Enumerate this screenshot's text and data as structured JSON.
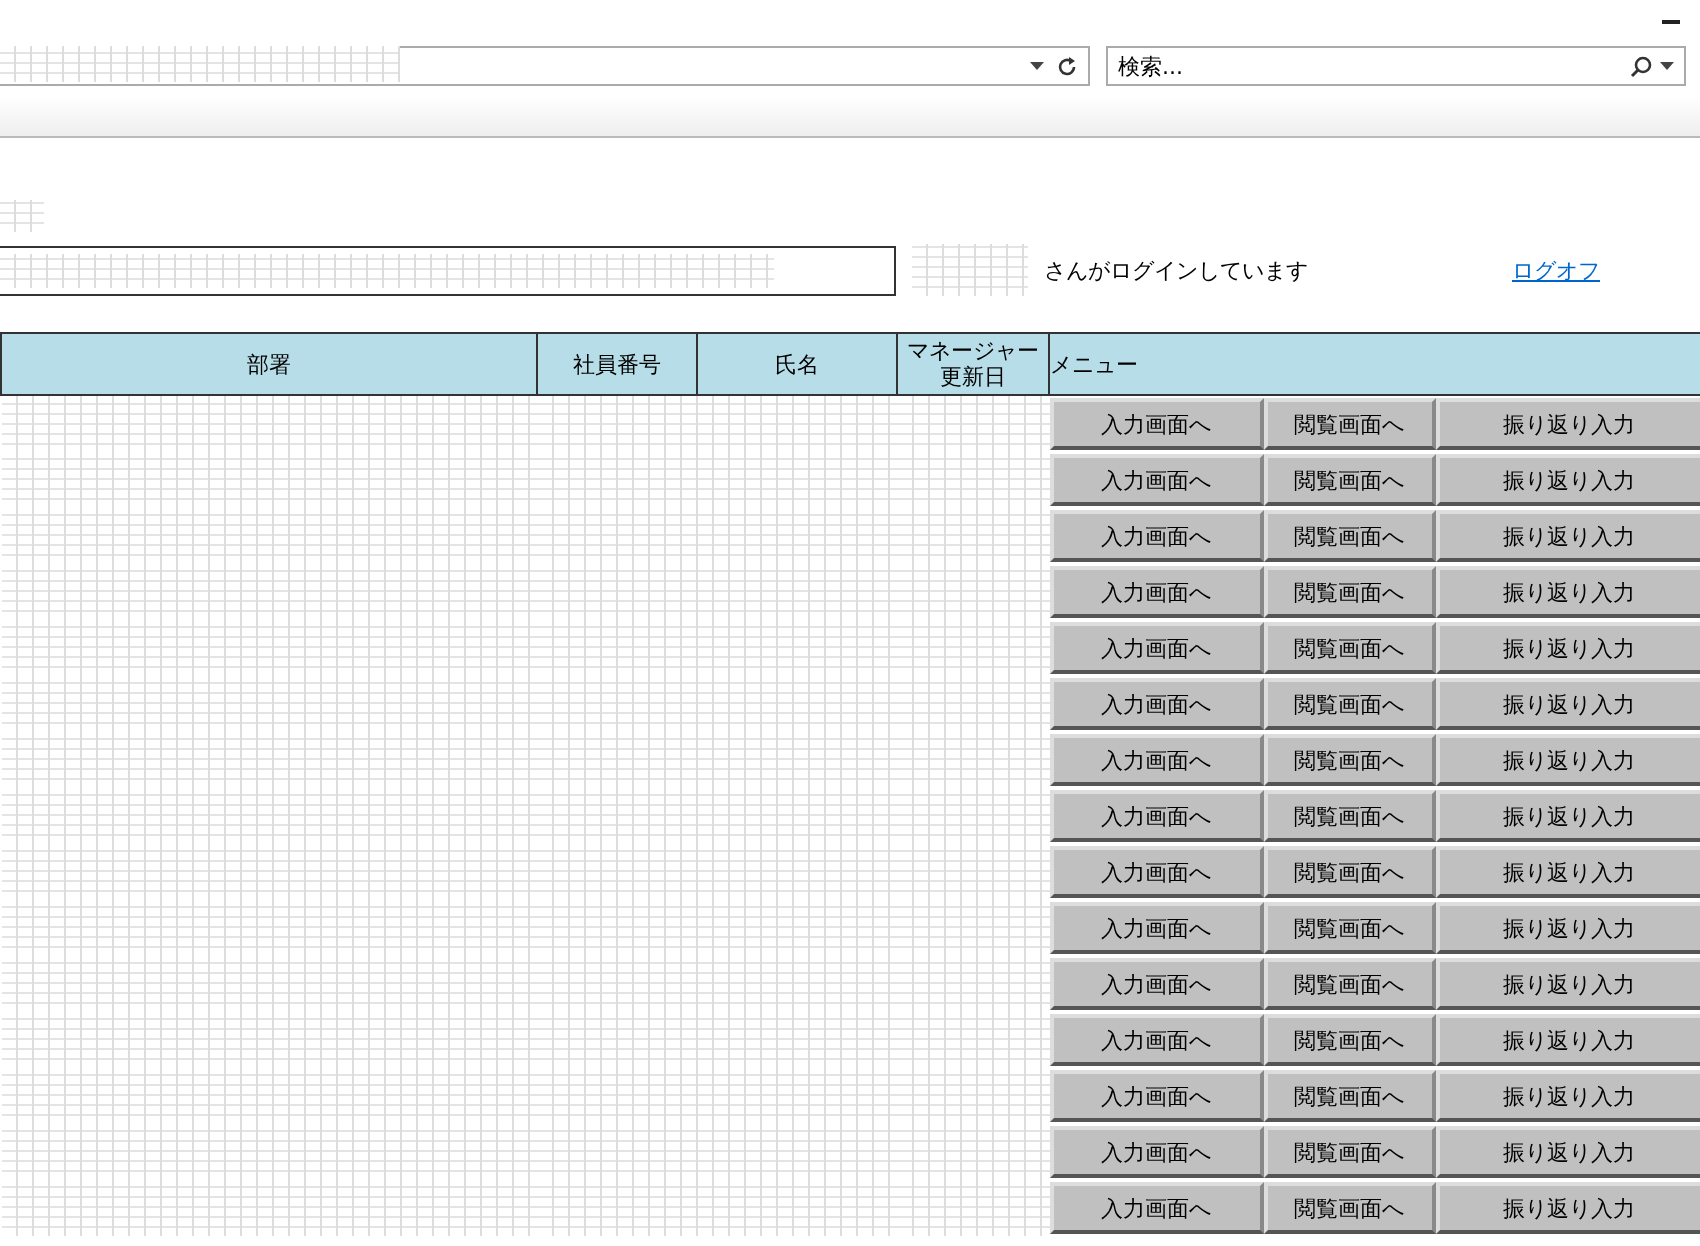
{
  "browser": {
    "search": {
      "placeholder": "検索..."
    }
  },
  "login": {
    "message": "さんがログインしています",
    "logoff": "ログオフ"
  },
  "table": {
    "columns": [
      "部署",
      "社員番号",
      "氏名",
      "マネージャー更新日",
      "メニュー"
    ],
    "rows": [
      {
        "buttons": [
          "入力画面へ",
          "閲覧画面へ",
          "振り返り入力"
        ]
      },
      {
        "buttons": [
          "入力画面へ",
          "閲覧画面へ",
          "振り返り入力"
        ]
      },
      {
        "buttons": [
          "入力画面へ",
          "閲覧画面へ",
          "振り返り入力"
        ]
      },
      {
        "buttons": [
          "入力画面へ",
          "閲覧画面へ",
          "振り返り入力"
        ]
      },
      {
        "buttons": [
          "入力画面へ",
          "閲覧画面へ",
          "振り返り入力"
        ]
      },
      {
        "buttons": [
          "入力画面へ",
          "閲覧画面へ",
          "振り返り入力"
        ]
      },
      {
        "buttons": [
          "入力画面へ",
          "閲覧画面へ",
          "振り返り入力"
        ]
      },
      {
        "buttons": [
          "入力画面へ",
          "閲覧画面へ",
          "振り返り入力"
        ]
      },
      {
        "buttons": [
          "入力画面へ",
          "閲覧画面へ",
          "振り返り入力"
        ]
      },
      {
        "buttons": [
          "入力画面へ",
          "閲覧画面へ",
          "振り返り入力"
        ]
      },
      {
        "buttons": [
          "入力画面へ",
          "閲覧画面へ",
          "振り返り入力"
        ]
      },
      {
        "buttons": [
          "入力画面へ",
          "閲覧画面へ",
          "振り返り入力"
        ]
      },
      {
        "buttons": [
          "入力画面へ",
          "閲覧画面へ",
          "振り返り入力"
        ]
      },
      {
        "buttons": [
          "入力画面へ",
          "閲覧画面へ",
          "振り返り入力"
        ]
      },
      {
        "buttons": [
          "入力画面へ",
          "閲覧画面へ",
          "振り返り入力"
        ]
      }
    ]
  }
}
